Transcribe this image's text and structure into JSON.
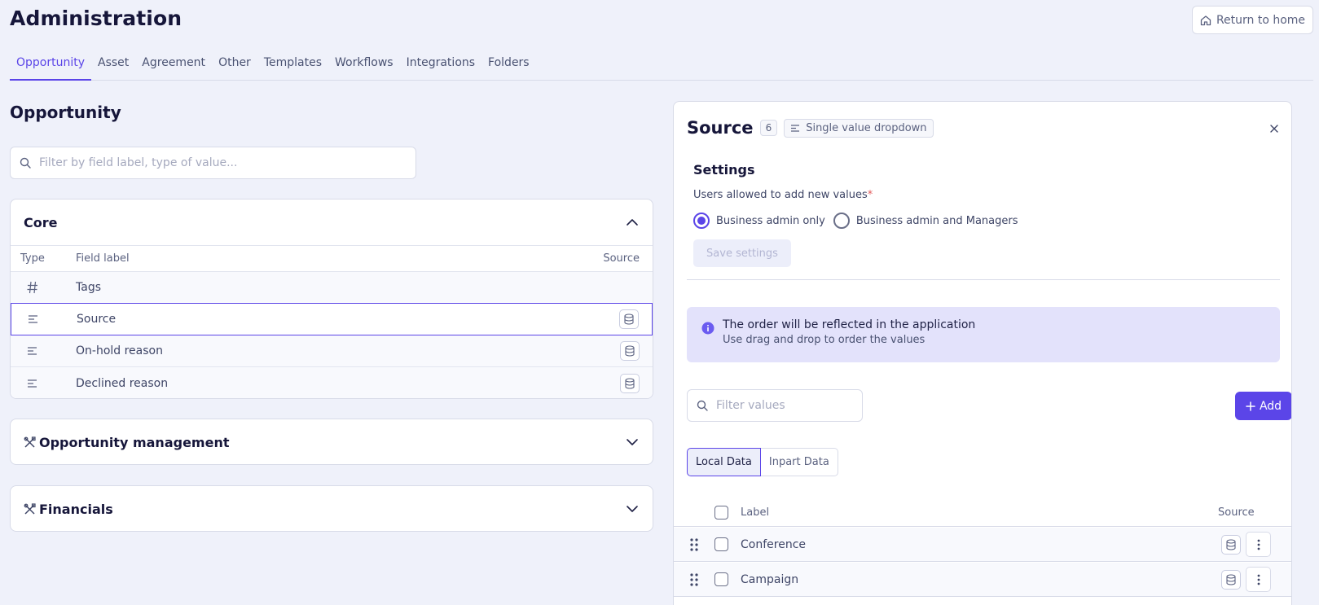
{
  "header": {
    "title": "Administration",
    "return_label": "Return to home"
  },
  "tabs": [
    {
      "label": "Opportunity",
      "active": true
    },
    {
      "label": "Asset"
    },
    {
      "label": "Agreement"
    },
    {
      "label": "Other"
    },
    {
      "label": "Templates"
    },
    {
      "label": "Workflows"
    },
    {
      "label": "Integrations"
    },
    {
      "label": "Folders"
    }
  ],
  "left": {
    "title": "Opportunity",
    "search_placeholder": "Filter by field label, type of value...",
    "core": {
      "title": "Core",
      "columns": {
        "type": "Type",
        "label": "Field label",
        "source": "Source"
      },
      "rows": [
        {
          "type_icon": "hash-icon",
          "label": "Tags",
          "has_source": false
        },
        {
          "type_icon": "dropdown-lines-icon",
          "label": "Source",
          "has_source": true,
          "selected": true
        },
        {
          "type_icon": "dropdown-lines-icon",
          "label": "On-hold reason",
          "has_source": true
        },
        {
          "type_icon": "dropdown-lines-icon",
          "label": "Declined reason",
          "has_source": true
        }
      ]
    },
    "opportunity_management": {
      "title": "Opportunity management"
    },
    "financials": {
      "title": "Financials"
    }
  },
  "detail": {
    "title": "Source",
    "count": "6",
    "type_label": "Single value dropdown",
    "settings": {
      "heading": "Settings",
      "users_label": "Users allowed to add new values",
      "required_mark": "*",
      "options": [
        {
          "label": "Business admin only",
          "selected": true
        },
        {
          "label": "Business admin and Managers",
          "selected": false
        }
      ],
      "save_label": "Save settings"
    },
    "info": {
      "line1": "The order will be reflected in the application",
      "line2": "Use drag and drop to order the values"
    },
    "values_search_placeholder": "Filter values",
    "add_label": "Add",
    "segments": [
      {
        "label": "Local Data",
        "active": true
      },
      {
        "label": "Inpart Data",
        "active": false
      }
    ],
    "values_columns": {
      "label": "Label",
      "source": "Source"
    },
    "values": [
      {
        "label": "Conference"
      },
      {
        "label": "Campaign"
      }
    ]
  },
  "colors": {
    "accent": "#5b45e8",
    "background": "#eff1fa",
    "info_bg": "#e3e2fb"
  }
}
